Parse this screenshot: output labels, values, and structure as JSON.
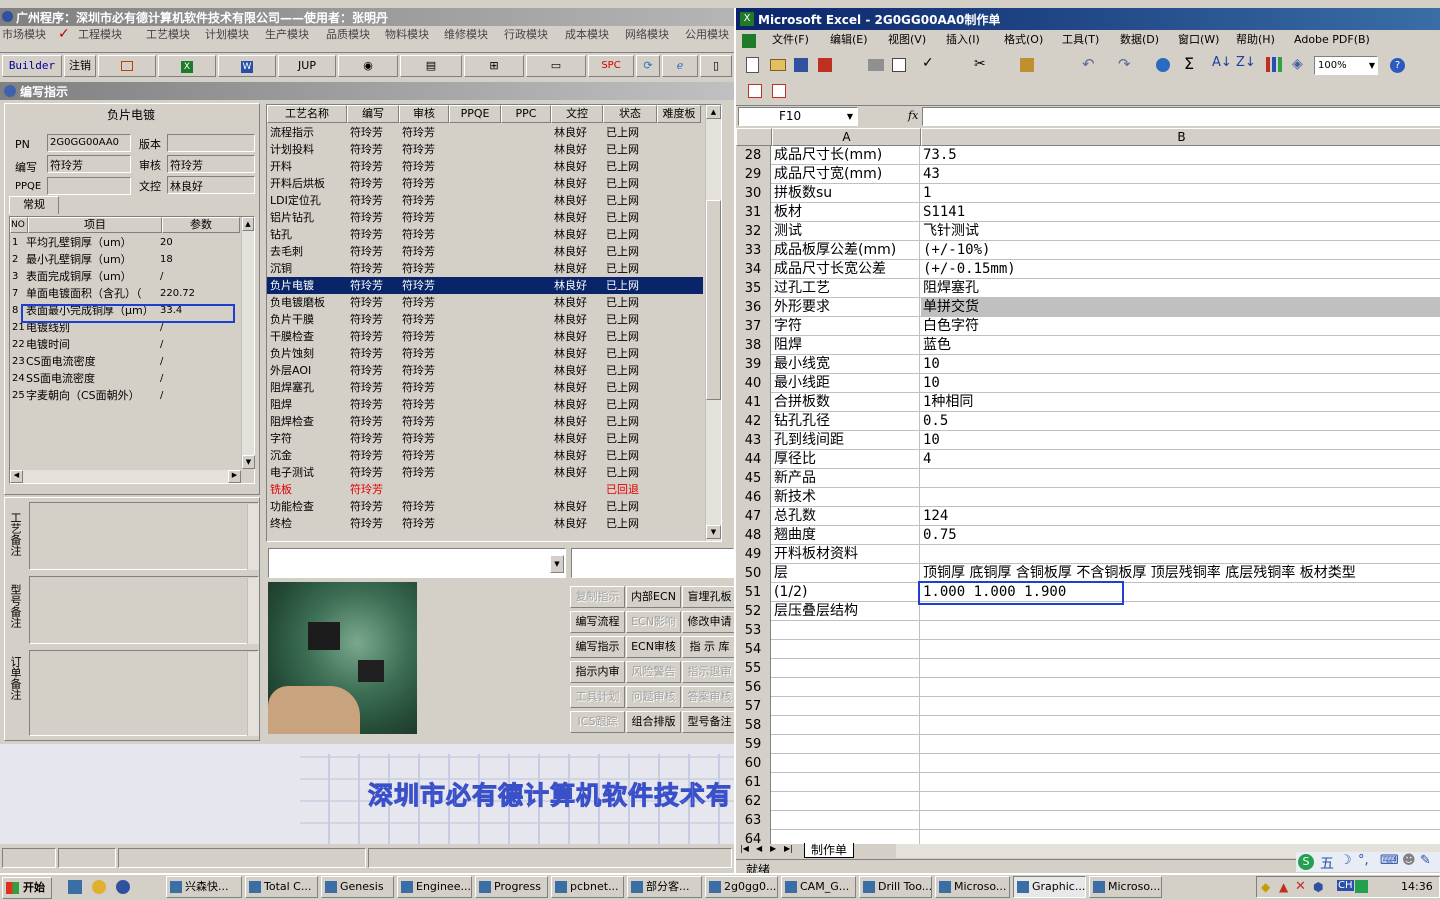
{
  "left_app": {
    "title": "广州程序：深圳市必有德计算机软件技术有限公司——使用者：张明丹",
    "menu": [
      "市场模块",
      "工程模块",
      "工艺模块",
      "计划模块",
      "生产模块",
      "品质模块",
      "物料模块",
      "维修模块",
      "行政模块",
      "成本模块",
      "网络模块",
      "公用模块"
    ],
    "toolbar": {
      "builder": "Builder",
      "logout": "注销",
      "jup": "JUP",
      "spc": "SPC"
    },
    "window_title": "编写指示",
    "process_name": "负片电镀",
    "form": {
      "pn_label": "PN",
      "pn_value": "2G0GG00AA0",
      "version_label": "版本",
      "version_value": "",
      "writer_label": "编写",
      "writer_value": "符玲芳",
      "review_label": "审核",
      "review_value": "符玲芳",
      "ppqe_label": "PPQE",
      "ppqe_value": "",
      "doc_label": "文控",
      "doc_value": "林良好"
    },
    "tab_general": "常规",
    "param_headers": [
      "NO",
      "项目",
      "参数"
    ],
    "params": [
      {
        "no": "1",
        "item": "平均孔壁铜厚（um）",
        "value": "20"
      },
      {
        "no": "2",
        "item": "最小孔壁铜厚（um）",
        "value": "18"
      },
      {
        "no": "3",
        "item": "表面完成铜厚（um）",
        "value": "/"
      },
      {
        "no": "7",
        "item": "单面电镀面积（含孔）（",
        "value": "220.72"
      },
      {
        "no": "8",
        "item": "表面最小完成铜厚（μm）",
        "value": "33.4"
      },
      {
        "no": "21",
        "item": "电镀线别",
        "value": "/"
      },
      {
        "no": "22",
        "item": "电镀时间",
        "value": "/"
      },
      {
        "no": "23",
        "item": "CS面电流密度",
        "value": "/"
      },
      {
        "no": "24",
        "item": "SS面电流密度",
        "value": "/"
      },
      {
        "no": "25",
        "item": "字麦朝向（CS面朝外）",
        "value": "/"
      }
    ],
    "note_labels": [
      "工艺备注",
      "型号备注",
      "订单备注"
    ],
    "proc_headers": [
      "工艺名称",
      "编写",
      "审核",
      "PPQE",
      "PPC",
      "文控",
      "状态",
      "难度板"
    ],
    "processes": [
      [
        "流程指示",
        "符玲芳",
        "符玲芳",
        "",
        "",
        "林良好",
        "已上网"
      ],
      [
        "计划投料",
        "符玲芳",
        "符玲芳",
        "",
        "",
        "林良好",
        "已上网"
      ],
      [
        "开料",
        "符玲芳",
        "符玲芳",
        "",
        "",
        "林良好",
        "已上网"
      ],
      [
        "开料后烘板",
        "符玲芳",
        "符玲芳",
        "",
        "",
        "林良好",
        "已上网"
      ],
      [
        "LDI定位孔",
        "符玲芳",
        "符玲芳",
        "",
        "",
        "林良好",
        "已上网"
      ],
      [
        "铝片钻孔",
        "符玲芳",
        "符玲芳",
        "",
        "",
        "林良好",
        "已上网"
      ],
      [
        "钻孔",
        "符玲芳",
        "符玲芳",
        "",
        "",
        "林良好",
        "已上网"
      ],
      [
        "去毛刺",
        "符玲芳",
        "符玲芳",
        "",
        "",
        "林良好",
        "已上网"
      ],
      [
        "沉铜",
        "符玲芳",
        "符玲芳",
        "",
        "",
        "林良好",
        "已上网"
      ],
      [
        "负片电镀",
        "符玲芳",
        "符玲芳",
        "",
        "",
        "林良好",
        "已上网"
      ],
      [
        "负电镀磨板",
        "符玲芳",
        "符玲芳",
        "",
        "",
        "林良好",
        "已上网"
      ],
      [
        "负片干膜",
        "符玲芳",
        "符玲芳",
        "",
        "",
        "林良好",
        "已上网"
      ],
      [
        "干膜检查",
        "符玲芳",
        "符玲芳",
        "",
        "",
        "林良好",
        "已上网"
      ],
      [
        "负片蚀刻",
        "符玲芳",
        "符玲芳",
        "",
        "",
        "林良好",
        "已上网"
      ],
      [
        "外层AOI",
        "符玲芳",
        "符玲芳",
        "",
        "",
        "林良好",
        "已上网"
      ],
      [
        "阻焊塞孔",
        "符玲芳",
        "符玲芳",
        "",
        "",
        "林良好",
        "已上网"
      ],
      [
        "阻焊",
        "符玲芳",
        "符玲芳",
        "",
        "",
        "林良好",
        "已上网"
      ],
      [
        "阻焊检查",
        "符玲芳",
        "符玲芳",
        "",
        "",
        "林良好",
        "已上网"
      ],
      [
        "字符",
        "符玲芳",
        "符玲芳",
        "",
        "",
        "林良好",
        "已上网"
      ],
      [
        "沉金",
        "符玲芳",
        "符玲芳",
        "",
        "",
        "林良好",
        "已上网"
      ],
      [
        "电子测试",
        "符玲芳",
        "符玲芳",
        "",
        "",
        "林良好",
        "已上网"
      ],
      [
        "铣板",
        "符玲芳",
        "",
        "",
        "",
        "",
        "已回退"
      ],
      [
        "功能检查",
        "符玲芳",
        "符玲芳",
        "",
        "",
        "林良好",
        "已上网"
      ],
      [
        "终检",
        "符玲芳",
        "符玲芳",
        "",
        "",
        "林良好",
        "已上网"
      ]
    ],
    "action_buttons": [
      [
        "复制指示",
        "内部ECN",
        "盲埋孔板"
      ],
      [
        "编写流程",
        "ECN影响",
        "修改申请"
      ],
      [
        "编写指示",
        "ECN审核",
        "指 示 库"
      ],
      [
        "指示内审",
        "风险警告",
        "指示退审"
      ],
      [
        "工具计划",
        "问题审核",
        "答案审核"
      ],
      [
        "ICS跟踪",
        "组合排版",
        "型号备注"
      ]
    ],
    "banner": "深圳市必有德计算机软件技术有"
  },
  "excel": {
    "title": "Microsoft Excel - 2G0GG00AA0制作单",
    "menu": [
      "文件(F)",
      "编辑(E)",
      "视图(V)",
      "插入(I)",
      "格式(O)",
      "工具(T)",
      "数据(D)",
      "窗口(W)",
      "帮助(H)",
      "Adobe PDF(B)"
    ],
    "zoom": "100%",
    "name_box": "F10",
    "fx": "fx",
    "col_a": "A",
    "col_b": "B",
    "rows": [
      [
        "28",
        "成品尺寸长(mm)",
        "73.5"
      ],
      [
        "29",
        "成品尺寸宽(mm)",
        "43"
      ],
      [
        "30",
        "拼板数su",
        "1"
      ],
      [
        "31",
        "板材",
        "S1141"
      ],
      [
        "32",
        "测试",
        "飞针测试"
      ],
      [
        "33",
        "成品板厚公差(mm)",
        "(+/-10%)"
      ],
      [
        "34",
        "成品尺寸长宽公差",
        "(+/-0.15mm)"
      ],
      [
        "35",
        "过孔工艺",
        "阻焊塞孔"
      ],
      [
        "36",
        "外形要求",
        "单拼交货"
      ],
      [
        "37",
        "字符",
        "白色字符"
      ],
      [
        "38",
        "阻焊",
        "蓝色"
      ],
      [
        "39",
        "最小线宽",
        "10"
      ],
      [
        "40",
        "最小线距",
        "10"
      ],
      [
        "41",
        "合拼板数",
        "1种相同"
      ],
      [
        "42",
        "钻孔孔径",
        "0.5"
      ],
      [
        "43",
        "孔到线间距",
        "10"
      ],
      [
        "44",
        "厚径比",
        "4"
      ],
      [
        "45",
        "新产品",
        ""
      ],
      [
        "46",
        "新技术",
        ""
      ],
      [
        "47",
        "总孔数",
        "124"
      ],
      [
        "48",
        "翘曲度",
        "0.75"
      ],
      [
        "49",
        "开料板材资料",
        ""
      ],
      [
        "50",
        "层",
        "顶铜厚  底铜厚  含铜板厚  不含铜板厚  顶层残铜率  底层残铜率  板材类型"
      ],
      [
        "51",
        "(1/2)",
        "1.000   1.000    1.900"
      ],
      [
        "52",
        "层压叠层结构",
        ""
      ],
      [
        "53",
        "",
        ""
      ],
      [
        "54",
        "",
        ""
      ],
      [
        "55",
        "",
        ""
      ],
      [
        "56",
        "",
        ""
      ],
      [
        "57",
        "",
        ""
      ],
      [
        "58",
        "",
        ""
      ],
      [
        "59",
        "",
        ""
      ],
      [
        "60",
        "",
        ""
      ],
      [
        "61",
        "",
        ""
      ],
      [
        "62",
        "",
        ""
      ],
      [
        "63",
        "",
        ""
      ],
      [
        "64",
        "",
        ""
      ]
    ],
    "sheet_tab": "制作单",
    "status": "就绪"
  },
  "taskbar": {
    "start": "开始",
    "tasks": [
      "兴森快...",
      "Total C...",
      "Genesis",
      "Enginee...",
      "Progress",
      "pcbnet...",
      "部分客...",
      "2g0gg0...",
      "CAM_G...",
      "Drill Too...",
      "Microso...",
      "Graphic...",
      "Microso..."
    ],
    "tray_ime": "CH",
    "clock": "14:36"
  },
  "colors": {
    "selection": "#0a246a",
    "highlight_box": "#1f3fd0",
    "title_active": "#0a246a",
    "banner": "#5a6cd0",
    "reverted": "#e00000"
  }
}
